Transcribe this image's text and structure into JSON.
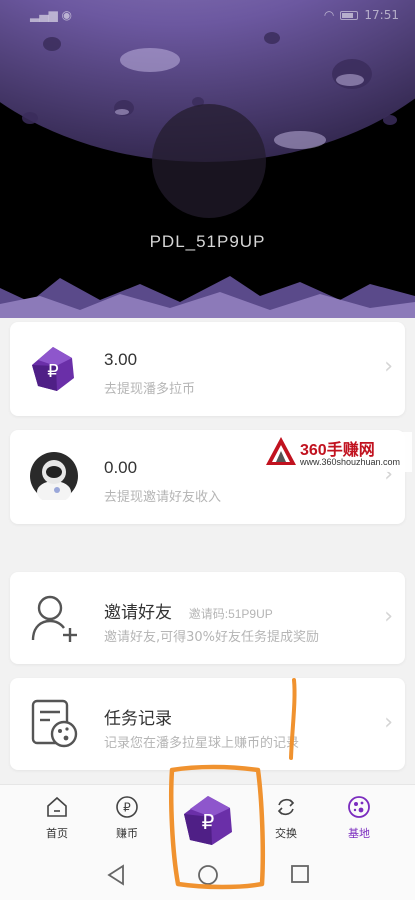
{
  "status_bar": {
    "time": "17:51"
  },
  "hero": {
    "username": "PDL_51P9UP"
  },
  "cards": [
    {
      "amount": "3.00",
      "subtitle": "去提现潘多拉币"
    },
    {
      "amount": "0.00",
      "subtitle": "去提现邀请好友收入"
    }
  ],
  "invite": {
    "title": "邀请好友",
    "code": "邀请码:51P9UP",
    "subtitle": "邀请好友,可得30%好友任务提成奖励"
  },
  "tasks": {
    "title": "任务记录",
    "subtitle": "记录您在潘多拉星球上赚币的记录"
  },
  "watermark": {
    "title": "360手赚网",
    "url": "www.360shouzhuan.com"
  },
  "tabs": [
    {
      "label": "首页",
      "icon": "home-icon"
    },
    {
      "label": "赚币",
      "icon": "coin-icon"
    },
    {
      "label": "交换",
      "icon": "exchange-icon"
    },
    {
      "label": "基地",
      "icon": "planet-icon"
    }
  ],
  "colors": {
    "accent": "#7b2cbf",
    "annotation": "#f0922f"
  }
}
